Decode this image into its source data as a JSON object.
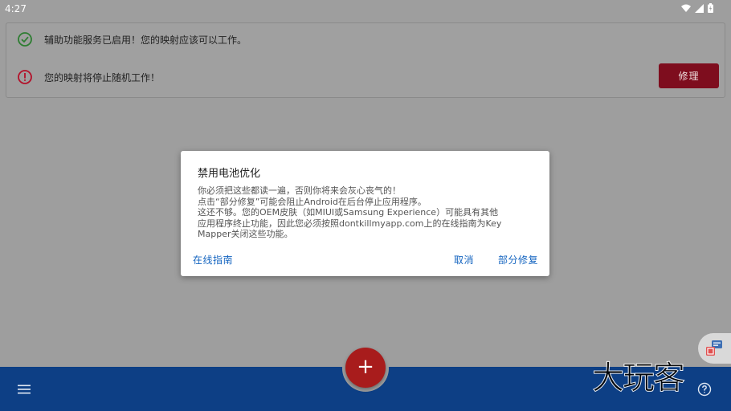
{
  "status_bar": {
    "time": "4:27",
    "icons": [
      "wifi-icon",
      "signal-icon",
      "battery-icon"
    ]
  },
  "status_card": {
    "rows": [
      {
        "icon": "check-circle-icon",
        "text": "辅助功能服务已启用！您的映射应该可以工作。",
        "color": "#2e7d32"
      },
      {
        "icon": "error-circle-icon",
        "text": "您的映射将停止随机工作！",
        "color": "#b3112a"
      }
    ],
    "fix_button_label": "修理"
  },
  "dialog": {
    "title": "禁用电池优化",
    "body_lines": [
      "你必须把这些都读一遍，否则你将来会灰心丧气的！",
      "点击“部分修复”可能会阻止Android在后台停止应用程序。",
      "这还不够。您的OEM皮肤（如MIUI或Samsung Experience）可能具有其他",
      "应用程序终止功能，因此您必须按照dontkillmyapp.com上的在线指南为Key",
      "Mapper关闭这些功能。"
    ],
    "actions": {
      "online_guide": "在线指南",
      "cancel": "取消",
      "partial_fix": "部分修复"
    }
  },
  "bottom_bar": {
    "fab_label": "+",
    "menu_icon": "menu-icon",
    "help_icon": "help-icon"
  },
  "watermark": "大玩客",
  "colors": {
    "bottom_bar": "#0d3f85",
    "fab": "#a81c1c",
    "fix_button": "#7e0d1e",
    "dialog_action": "#1565c0"
  }
}
